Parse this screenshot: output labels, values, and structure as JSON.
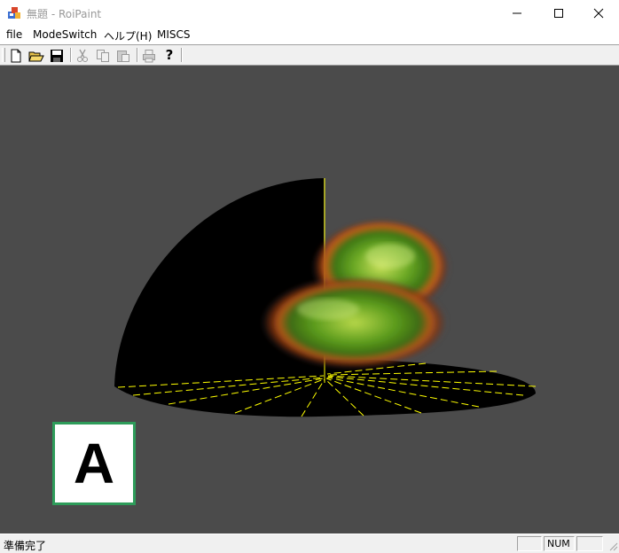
{
  "window": {
    "title": "無題 - RoiPaint"
  },
  "menu": [
    "file",
    "ModeSwitch",
    "ヘルプ(H)",
    "MISCS"
  ],
  "toolbar": {
    "buttons": [
      "new-file",
      "open-folder",
      "save",
      "cut",
      "copy",
      "paste",
      "print",
      "help"
    ]
  },
  "badge": {
    "letter": "A",
    "border_color": "#2e9c5a"
  },
  "status": {
    "text": "準備完了",
    "num": "NUM"
  },
  "colors": {
    "viewport_bg": "#4b4b4b",
    "guide_lines": "#ffff00"
  }
}
